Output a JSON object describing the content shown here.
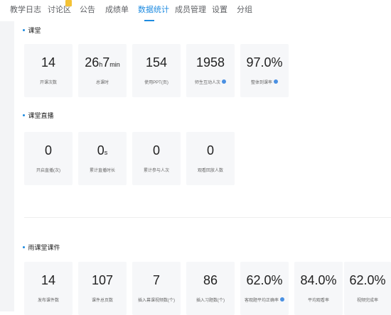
{
  "nav": {
    "tabs": [
      {
        "label": "教学日志"
      },
      {
        "label": "讨论区"
      },
      {
        "label": "公告"
      },
      {
        "label": "成绩单"
      },
      {
        "label": "数据统计"
      },
      {
        "label": "成员管理"
      },
      {
        "label": "设置"
      },
      {
        "label": "分组"
      }
    ],
    "active_tab": "数据统计",
    "accent_color": "#1e8be0"
  },
  "sections": {
    "classroom": {
      "title": "课堂",
      "cards": [
        {
          "value": "14",
          "label": "开课次数"
        },
        {
          "value_main": "26",
          "unit_h": "h",
          "value_min": "7",
          "unit_min": "min",
          "label": "总课时"
        },
        {
          "value": "154",
          "label": "使用PPT(页)"
        },
        {
          "value": "1958",
          "label": "师生互动人次"
        },
        {
          "value": "97.0%",
          "label": "整体到课率"
        }
      ]
    },
    "live": {
      "title": "课堂直播",
      "cards": [
        {
          "value": "0",
          "label": "开启直播(次)"
        },
        {
          "value": "0",
          "unit": "s",
          "label": "累计直播时长"
        },
        {
          "value": "0",
          "label": "累计参与人次"
        },
        {
          "value": "0",
          "label": "观看回放人数"
        }
      ]
    },
    "courseware": {
      "title": "雨课堂课件",
      "cards": [
        {
          "value": "14",
          "label": "发布课件数"
        },
        {
          "value": "107",
          "label": "课件总页数"
        },
        {
          "value": "7",
          "label": "插入幕课视频数(个)"
        },
        {
          "value": "86",
          "label": "插入习题数(个)"
        },
        {
          "value": "62.0%",
          "label": "客观题平均正确率"
        },
        {
          "value": "84.0%",
          "label": "平均观看率"
        },
        {
          "value": "62.0%",
          "label": "视频完成率"
        }
      ]
    }
  }
}
